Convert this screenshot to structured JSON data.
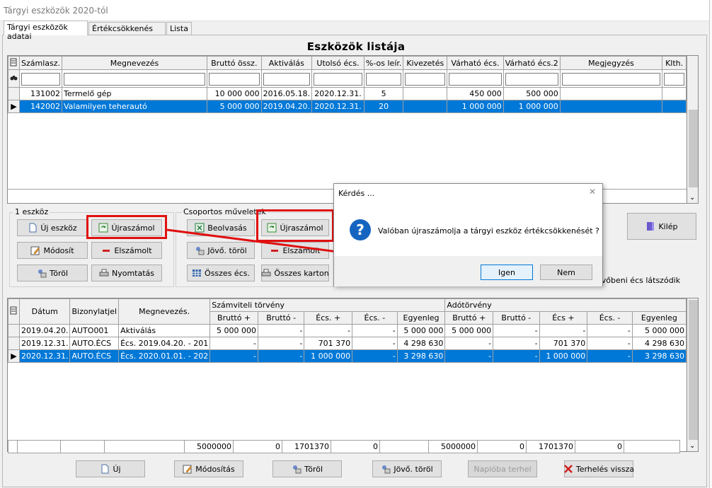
{
  "window": {
    "title": "Tárgyi eszközök 2020-tól"
  },
  "tabs": [
    "Tárgyi eszközök adatai",
    "Értékcsökkenés terv",
    "Lista"
  ],
  "asset_list": {
    "title": "Eszközök listája",
    "columns": [
      "Számlasz.",
      "Megnevezés",
      "Bruttó össz.",
      "Aktiválás",
      "Utolsó écs.",
      "%-os leír.",
      "Kivezetés",
      "Várható écs.",
      "Várható écs.2",
      "Megjegyzés",
      "Klth."
    ],
    "rows": [
      [
        "131002",
        "Termelő gép",
        "10 000 000",
        "2016.05.18.",
        "2020.12.31.",
        "5",
        "",
        "450 000",
        "500 000",
        "",
        ""
      ],
      [
        "142002",
        "Valamilyen teherautó",
        "5 000 000",
        "2019.04.20.",
        "2020.12.31.",
        "20",
        "",
        "1 000 000",
        "1 000 000",
        "",
        ""
      ]
    ],
    "selected_row": 1
  },
  "group_single": {
    "label": "1 eszköz",
    "buttons": [
      "Új eszköz",
      "Újraszámol",
      "Módosít",
      "Elszámolt",
      "Töröl",
      "Nyomtatás"
    ]
  },
  "group_multi": {
    "label": "Csoportos műveletek",
    "buttons": [
      "Beolvasás",
      "Újraszámol",
      "Jövő. töröl",
      "Elszámolt",
      "Összes écs.",
      "Összes karton"
    ]
  },
  "exit_button": "Kilép",
  "partial_text": "jövőbeni écs látszódik",
  "dialog": {
    "title": "Kérdés ...",
    "message": "Valóban újraszámolja a tárgyi eszköz értékcsökkenését ?",
    "yes": "Igen",
    "no": "Nem",
    "close": "✕",
    "icon": "question-icon"
  },
  "ledger": {
    "headers_top": [
      "Dátum",
      "Bizonylatjel",
      "Megnevezés.",
      "Számviteli törvény",
      "Adótörvény"
    ],
    "headers_sub": [
      "Bruttó +",
      "Bruttó -",
      "Écs. +",
      "Écs. -",
      "Egyenleg",
      "Bruttó +",
      "Bruttó -",
      "Écs +",
      "Écs. -",
      "Egyenleg"
    ],
    "rows": [
      [
        "2019.04.20.",
        "AUTO001",
        "Aktiválás",
        "5 000 000",
        "-",
        "-",
        "-",
        "5 000 000",
        "5 000 000",
        "-",
        "-",
        "-",
        "5 000 000"
      ],
      [
        "2019.12.31.",
        "AUTO.ÉCS",
        "Écs. 2019.04.20. - 201",
        "-",
        "-",
        "701 370",
        "-",
        "4 298 630",
        "-",
        "-",
        "701 370",
        "-",
        "4 298 630"
      ],
      [
        "2020.12.31.",
        "AUTO.ÉCS",
        "Écs. 2020.01.01. - 202",
        "-",
        "-",
        "1 000 000",
        "-",
        "3 298 630",
        "-",
        "-",
        "1 000 000",
        "-",
        "3 298 630"
      ]
    ],
    "selected_row": 2,
    "totals": [
      "5000000",
      "0",
      "1701370",
      "0",
      "",
      "5000000",
      "0",
      "1701370",
      "0",
      ""
    ]
  },
  "bottom_buttons": [
    "Új",
    "Módosítás",
    "Töröl",
    "Jövő. töröl",
    "Naplóba terhel",
    "Terhelés vissza"
  ],
  "colors": {
    "selection": "#0078d7",
    "highlight": "#e01010",
    "dialog_icon": "#1565c0"
  }
}
